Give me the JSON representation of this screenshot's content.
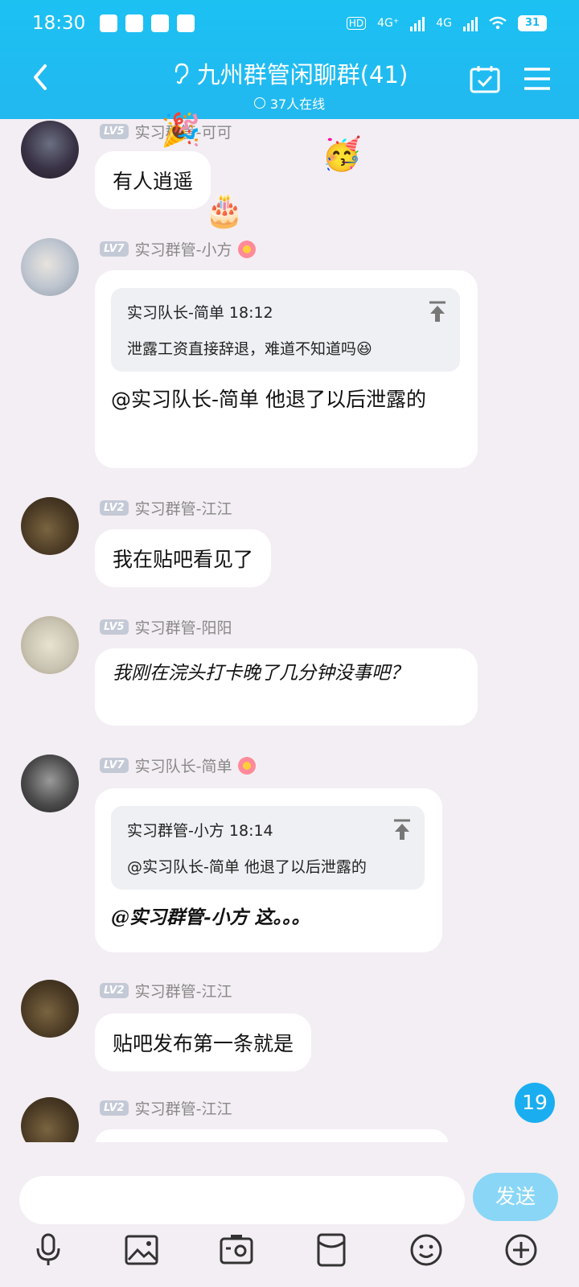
{
  "status": {
    "time": "18:30",
    "net1": "4G⁺",
    "net2": "4G",
    "battery": "31"
  },
  "header": {
    "title": "九州群管闲聊群(41)",
    "online": "37人在线"
  },
  "messages": [
    {
      "level": "LV5",
      "name": "实习群管-可可",
      "text": "有人逍遥"
    },
    {
      "level": "LV7",
      "name": "实习群管-小方",
      "quote_head": "实习队长-简单 18:12",
      "quote_body": "泄露工资直接辞退，难道不知道吗",
      "text": "@实习队长-简单 他退了以后泄露的"
    },
    {
      "level": "LV2",
      "name": "实习群管-江江",
      "text": "我在贴吧看见了"
    },
    {
      "level": "LV5",
      "name": "实习群管-阳阳",
      "text": "我刚在浣头打卡晚了几分钟没事吧？"
    },
    {
      "level": "LV7",
      "name": "实习队长-简单",
      "quote_head": "实习群管-小方 18:14",
      "quote_body": "@实习队长-简单 他退了以后泄露的",
      "text": "@实习群管-小方 这。。。"
    },
    {
      "level": "LV2",
      "name": "实习群管-江江",
      "text": "贴吧发布第一条就是"
    },
    {
      "level": "LV2",
      "name": "实习群管-江江"
    }
  ],
  "unread_count": "19",
  "composer": {
    "value": "",
    "send_label": "发送"
  },
  "icons": [
    "back-icon",
    "ear-icon",
    "calendar-check-icon",
    "menu-icon",
    "microphone-icon",
    "image-icon",
    "camera-icon",
    "red-packet-icon",
    "emoji-icon",
    "plus-icon"
  ],
  "colors": {
    "accent": "#1cc1f2",
    "background": "#f3eef3",
    "send": "#8ad6f6"
  }
}
